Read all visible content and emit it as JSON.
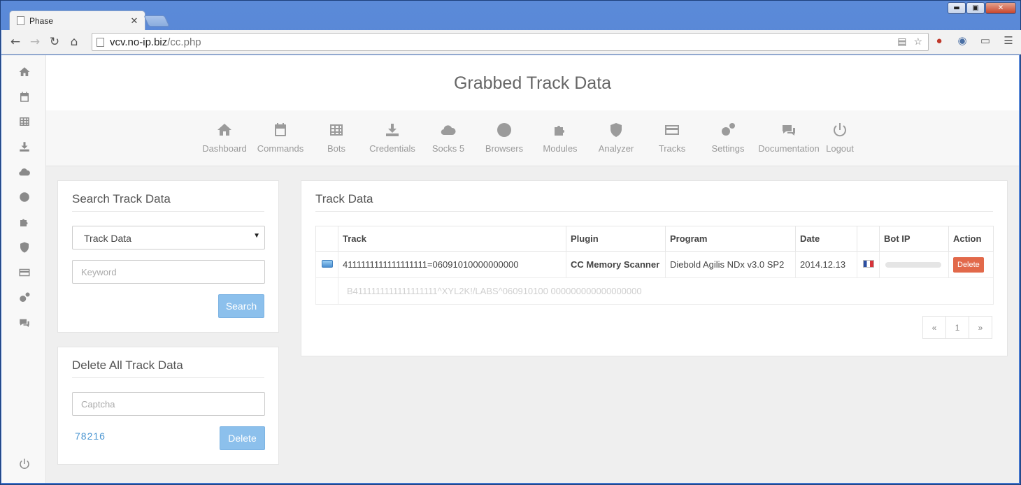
{
  "browser": {
    "tab_title": "Phase",
    "tab_close": "✕",
    "url_host": "vcv.no-ip.biz",
    "url_path": "/cc.php",
    "win_min": "▬",
    "win_max": "▣",
    "win_close": "✕"
  },
  "header": {
    "title": "Grabbed Track Data"
  },
  "topnav": [
    {
      "label": "Dashboard",
      "icon": "home-icon"
    },
    {
      "label": "Commands",
      "icon": "calendar-icon"
    },
    {
      "label": "Bots",
      "icon": "grid-icon"
    },
    {
      "label": "Credentials",
      "icon": "download-icon"
    },
    {
      "label": "Socks 5",
      "icon": "cloud-icon"
    },
    {
      "label": "Browsers",
      "icon": "globe-icon"
    },
    {
      "label": "Modules",
      "icon": "puzzle-icon"
    },
    {
      "label": "Analyzer",
      "icon": "shield-icon"
    },
    {
      "label": "Tracks",
      "icon": "credit-card-icon"
    },
    {
      "label": "Settings",
      "icon": "gears-icon"
    },
    {
      "label": "Documentation",
      "icon": "comments-icon"
    },
    {
      "label": "Logout",
      "icon": "power-icon"
    }
  ],
  "search_panel": {
    "title": "Search Track Data",
    "select_value": "Track Data",
    "keyword_placeholder": "Keyword",
    "search_button": "Search"
  },
  "delete_panel": {
    "title": "Delete All Track Data",
    "captcha_placeholder": "Captcha",
    "captcha_code": "78216",
    "delete_button": "Delete"
  },
  "track_panel": {
    "title": "Track Data",
    "columns": [
      "",
      "Track",
      "Plugin",
      "Program",
      "Date",
      "",
      "Bot IP",
      "Action"
    ],
    "rows": [
      {
        "track": "4111111111111111111=06091010000000000",
        "plugin": "CC Memory Scanner",
        "program": "Diebold Agilis NDx v3.0 SP2",
        "date": "2014.12.13",
        "action": "Delete",
        "raw": "B4111111111111111111^XYL2K!/LABS^060910100 000000000000000000"
      }
    ],
    "pager": [
      "«",
      "1",
      "»"
    ]
  },
  "colors": {
    "accent_blue": "#8cc0ec",
    "delete_red": "#e2694a"
  }
}
